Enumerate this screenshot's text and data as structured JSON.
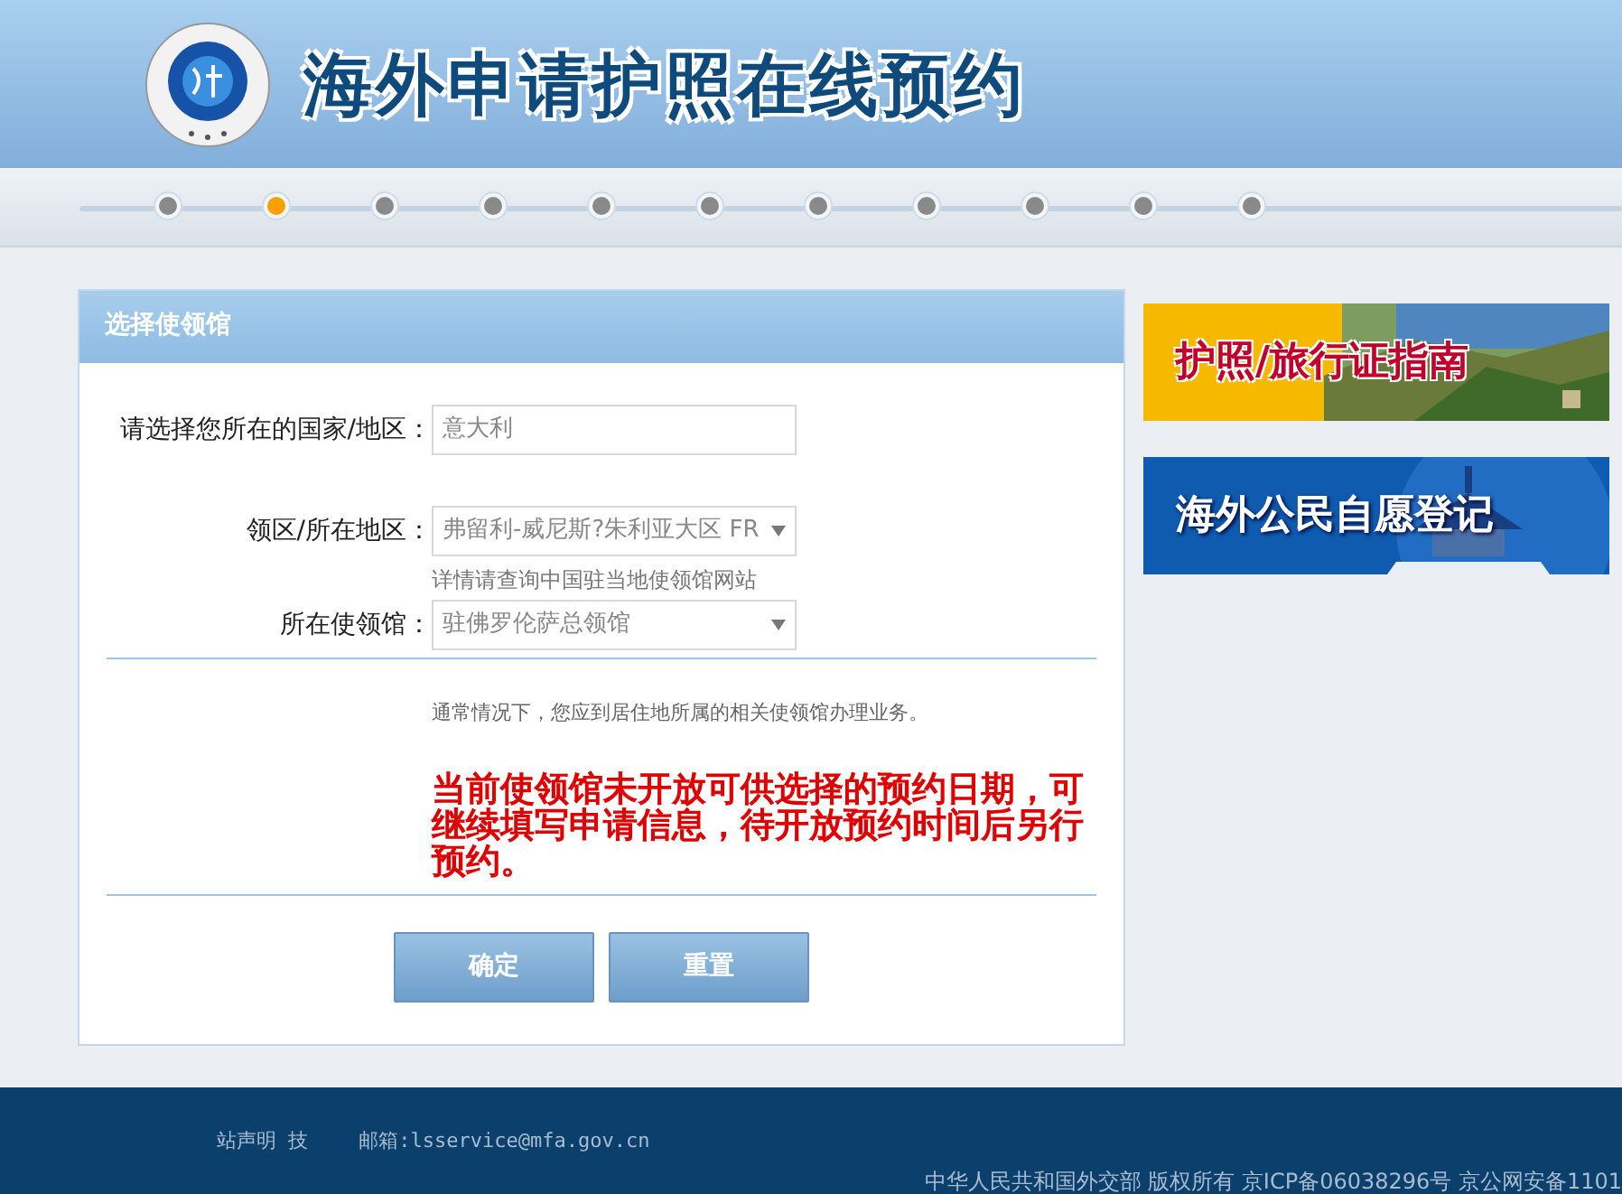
{
  "header": {
    "title": "海外申请护照在线预约"
  },
  "steps": [
    {
      "selected": false
    },
    {
      "selected": true
    },
    {
      "selected": false
    },
    {
      "selected": false
    },
    {
      "selected": false
    },
    {
      "selected": false
    },
    {
      "selected": false
    },
    {
      "selected": false
    },
    {
      "selected": false
    },
    {
      "selected": false
    },
    {
      "selected": false
    }
  ],
  "panel": {
    "title": "选择使领馆",
    "fields": [
      {
        "kind": "input",
        "label": "请选择您所在的国家/地区：",
        "value": "意大利"
      },
      {
        "kind": "select",
        "label": "领区/所在地区：",
        "value": "弗留利-威尼斯?朱利亚大区 FR",
        "hint": "详情请查询中国驻当地使领馆网站"
      },
      {
        "kind": "select",
        "label": "所在使领馆：",
        "value": "驻佛罗伦萨总领馆"
      }
    ],
    "note": "通常情况下，您应到居住地所属的相关使领馆办理业务。",
    "warning": "当前使领馆未开放可供选择的预约日期，可继续填写申请信息，待开放预约时间后另行预约。",
    "buttons": [
      "确定",
      "重置"
    ]
  },
  "banners": [
    {
      "text": "护照/旅行证指南",
      "kind": "wall"
    },
    {
      "text": "海外公民自愿登记",
      "kind": "temple"
    }
  ],
  "footer": {
    "line_1": [
      "站声明 技",
      "邮箱:lsservice@mfa.gov.cn"
    ],
    "line_2": "中华人民共和国外交部 版权所有 京ICP备06038296号 京公网安备1101"
  }
}
